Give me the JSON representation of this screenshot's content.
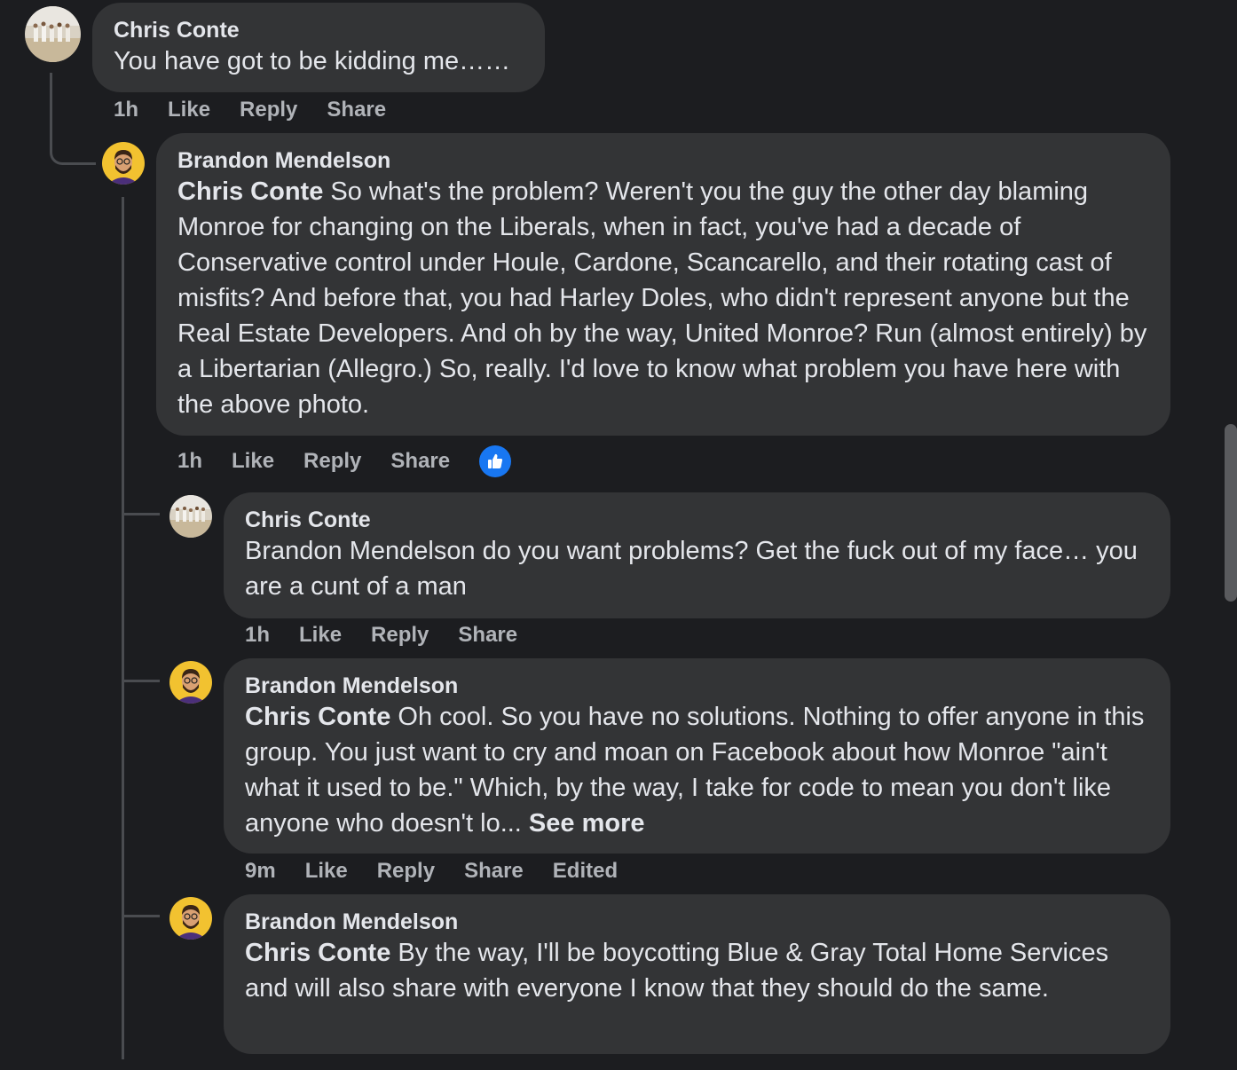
{
  "comments": [
    {
      "author": "Chris Conte",
      "text": "You have got to be kidding me……",
      "time": "1h",
      "like": "Like",
      "reply": "Reply",
      "share": "Share"
    },
    {
      "author": "Brandon Mendelson",
      "mention": "Chris Conte",
      "text": " So what's the problem? Weren't you the guy the other day blaming Monroe for changing on the Liberals, when in fact, you've had a decade of Conservative control under Houle, Cardone, Scancarello, and their rotating cast of misfits? And before that, you had Harley Doles, who didn't represent anyone but the Real Estate Developers. And oh by the way, United Monroe? Run (almost entirely) by a Libertarian (Allegro.) So, really. I'd love to know what problem you have here with the above photo.",
      "time": "1h",
      "like": "Like",
      "reply": "Reply",
      "share": "Share"
    },
    {
      "author": "Chris Conte",
      "text": "Brandon Mendelson do you want problems? Get the fuck out of my face… you are a cunt of a man",
      "time": "1h",
      "like": "Like",
      "reply": "Reply",
      "share": "Share"
    },
    {
      "author": "Brandon Mendelson",
      "mention": "Chris Conte",
      "text": " Oh cool. So you have no solutions. Nothing to offer anyone in this group. You just want to cry and moan on Facebook about how Monroe \"ain't what it used to be.\" Which, by the way, I take for code to mean you don't like anyone who doesn't lo... ",
      "see_more": "See more",
      "time": "9m",
      "like": "Like",
      "reply": "Reply",
      "share": "Share",
      "edited": "Edited"
    },
    {
      "author": "Brandon Mendelson",
      "mention": "Chris Conte",
      "text": " By the way, I'll be boycotting Blue & Gray Total Home Services and will also share with everyone I know that they should do the same."
    }
  ],
  "colors": {
    "background": "#1c1d20",
    "bubble": "#333436",
    "secondary_text": "#b0b3b8",
    "like_badge": "#1877f2"
  }
}
